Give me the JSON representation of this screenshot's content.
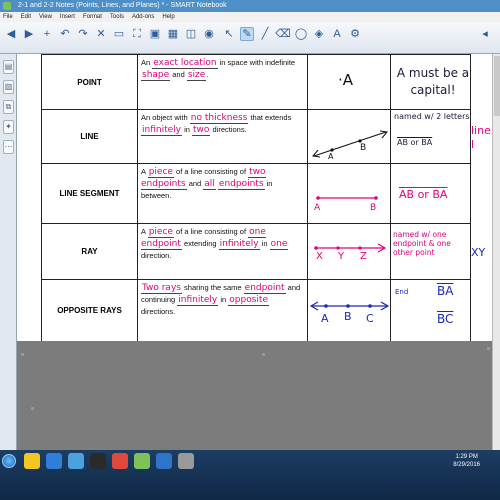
{
  "window": {
    "title": "2-1 and 2-2 Notes (Points, Lines, and Planes) * - SMART Notebook"
  },
  "menu": [
    "File",
    "Edit",
    "View",
    "Insert",
    "Format",
    "Tools",
    "Add-ons",
    "Help"
  ],
  "toolbar_icons": [
    "undo-icon",
    "redo-icon",
    "delete-icon",
    "screen-shade-icon",
    "fullscreen-icon",
    "display-icon",
    "table-icon",
    "capture-icon",
    "document-camera-icon",
    "select-icon",
    "pen-icon",
    "eraser-icon",
    "line-icon",
    "shape-icon",
    "fill-icon",
    "text-icon",
    "properties-icon"
  ],
  "rows": [
    {
      "term": "POINT",
      "def": [
        "An ",
        {
          "hw": "exact location"
        },
        " in space with indefinite ",
        {
          "hw": "shape"
        },
        " and ",
        {
          "hw": "size"
        },
        "."
      ],
      "pic_label": "·A",
      "note": "A must be a capital!"
    },
    {
      "term": "LINE",
      "def": [
        "An object with ",
        {
          "hw": "no thickness"
        },
        " that extends ",
        {
          "hw": "infinitely"
        },
        " in ",
        {
          "hw": "two"
        },
        " directions."
      ],
      "pic_labels": [
        "A",
        "B"
      ],
      "note": "named w/ 2 letters",
      "note2": "AB or BA",
      "extra": "line l"
    },
    {
      "term": "LINE SEGMENT",
      "def": [
        "A ",
        {
          "hw": "piece"
        },
        " of a line consisting of ",
        {
          "hw": "two endpoints"
        },
        " and ",
        {
          "hw": "all"
        },
        " ",
        {
          "hw": "endpoints"
        },
        " in between."
      ],
      "pic_labels": [
        "A",
        "B"
      ],
      "note": "AB or BA"
    },
    {
      "term": "RAY",
      "def": [
        "A ",
        {
          "hw": "piece"
        },
        " of a line consisting of ",
        {
          "hw": "one endpoint"
        },
        " extending ",
        {
          "hw": "infinitely"
        },
        " in ",
        {
          "hw": "one"
        },
        " direction."
      ],
      "pic_labels": [
        "X",
        "Y",
        "Z"
      ],
      "note": "named w/ one endpoint & one other point",
      "extra": "XY"
    },
    {
      "term": "OPPOSITE RAYS",
      "def": [
        {
          "hw": "Two rays"
        },
        " sharing the same ",
        {
          "hw": "endpoint"
        },
        " and continuing ",
        {
          "hw": "infinitely"
        },
        " in ",
        {
          "hw": "opposite"
        },
        " directions."
      ],
      "pic_labels": [
        "A",
        "B",
        "C"
      ],
      "note": "End",
      "note2": [
        "BA",
        "BC"
      ]
    }
  ],
  "tray": {
    "time": "1:29 PM",
    "date": "8/29/2016"
  }
}
